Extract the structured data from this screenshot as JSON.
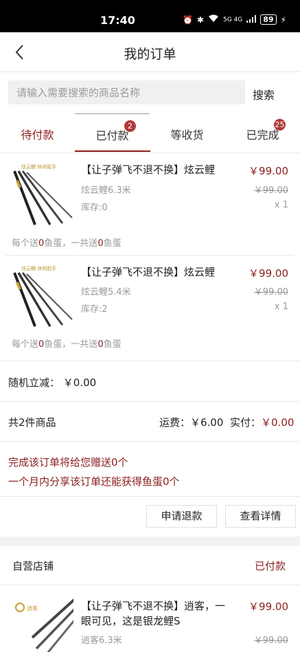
{
  "status_bar": {
    "time": "17:40",
    "battery": "89",
    "net": "5G 4G"
  },
  "header": {
    "title": "我的订单"
  },
  "search": {
    "placeholder": "请输入需要搜索的商品名称",
    "button_label": "搜索"
  },
  "tabs": [
    {
      "label": "待付款",
      "badge": ""
    },
    {
      "label": "已付款",
      "badge": "2"
    },
    {
      "label": "等收货",
      "badge": ""
    },
    {
      "label": "已完成",
      "badge": "25"
    }
  ],
  "order1": {
    "items": [
      {
        "title": "【让子弹飞不退不换】炫云鲤",
        "spec": "炫云鲤6.3米",
        "stock": "库存:0",
        "price": "￥99.00",
        "old_price": "￥99.00",
        "qty": "x 1",
        "egg_a": "每个送",
        "egg_each": "0",
        "egg_b": "鱼蛋，一共送",
        "egg_total": "0",
        "egg_c": "鱼蛋"
      },
      {
        "title": "【让子弹飞不退不换】炫云鲤",
        "spec": "炫云鲤5.4米",
        "stock": "库存:2",
        "price": "￥99.00",
        "old_price": "￥99.00",
        "qty": "x 1",
        "egg_a": "每个送",
        "egg_each": "0",
        "egg_b": "鱼蛋，一共送",
        "egg_total": "0",
        "egg_c": "鱼蛋"
      }
    ],
    "discount_label": "随机立减：",
    "discount_value": "￥0.00",
    "count_text": "共2件商品",
    "shipping_text": "运费：￥6.00",
    "paid_label": "实付：",
    "paid_value": "￥0.00",
    "reward_line1": "完成该订单将给您赠送0个",
    "reward_line2": "一个月内分享该订单还能获得鱼蛋0个",
    "refund_button": "申请退款",
    "detail_button": "查看详情"
  },
  "order2": {
    "shop_name": "自营店铺",
    "status": "已付款",
    "item": {
      "title_line1": "【让子弹飞不退不换】逍客，一",
      "title_line2": "眼可见，这是银龙鲤S",
      "spec": "逍客6.3米",
      "price": "￥99.00",
      "old_price": "￥99.00"
    }
  },
  "icons": {
    "back": "chevron-left-icon",
    "product_image": "fishing-rod-image"
  },
  "colors": {
    "accent": "#8b1d1d",
    "badge": "#b03a3a"
  }
}
